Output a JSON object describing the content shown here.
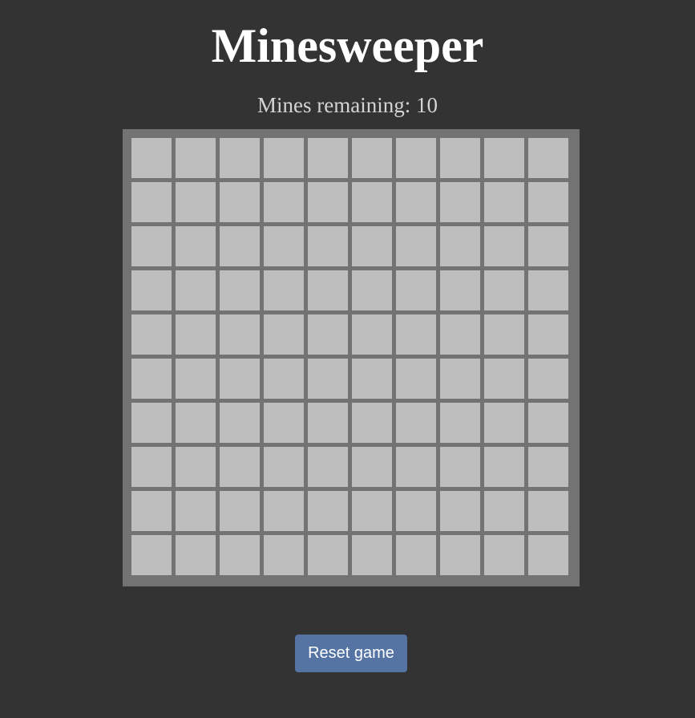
{
  "header": {
    "title": "Minesweeper",
    "mines_label": "Mines remaining: ",
    "mines_remaining": 10
  },
  "board": {
    "rows": 10,
    "columns": 10,
    "cell_state": "unrevealed"
  },
  "controls": {
    "reset_label": "Reset game"
  },
  "colors": {
    "background": "#333333",
    "board_frame": "#737373",
    "cell_unrevealed": "#bebebe",
    "title_text": "#ffffff",
    "counter_text": "#d4d4d4",
    "reset_button": "#5574a3"
  }
}
